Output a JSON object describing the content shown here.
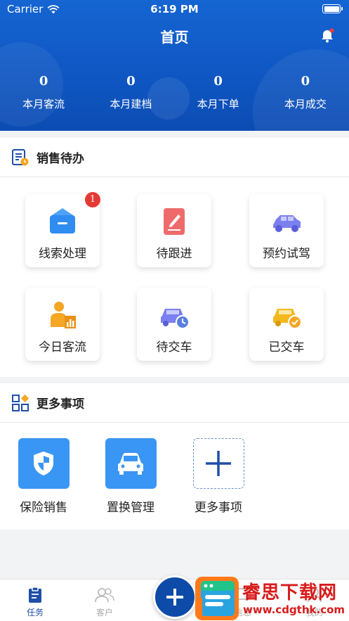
{
  "status_bar": {
    "carrier": "Carrier",
    "time": "6:19 PM"
  },
  "header": {
    "title": "首页",
    "stats": [
      {
        "value": "0",
        "label": "本月客流"
      },
      {
        "value": "0",
        "label": "本月建档"
      },
      {
        "value": "0",
        "label": "本月下单"
      },
      {
        "value": "0",
        "label": "本月成交"
      }
    ]
  },
  "sales_todo": {
    "title": "销售待办",
    "items": [
      {
        "label": "线索处理",
        "icon": "lead-inbox-icon",
        "badge": "1"
      },
      {
        "label": "待跟进",
        "icon": "follow-up-note-icon"
      },
      {
        "label": "预约试驾",
        "icon": "test-drive-car-icon"
      },
      {
        "label": "今日客流",
        "icon": "visitor-chart-icon"
      },
      {
        "label": "待交车",
        "icon": "car-clock-icon"
      },
      {
        "label": "已交车",
        "icon": "car-check-icon"
      }
    ]
  },
  "more": {
    "title": "更多事项",
    "items": [
      {
        "label": "保险销售",
        "icon": "shield-icon"
      },
      {
        "label": "置换管理",
        "icon": "car-icon"
      },
      {
        "label": "更多事项",
        "icon": "plus-icon"
      }
    ]
  },
  "tab_bar": {
    "tabs": [
      {
        "label": "任务",
        "icon": "clipboard-icon"
      },
      {
        "label": "客户",
        "icon": "users-icon"
      },
      {
        "label": "信息",
        "icon": "message-icon"
      },
      {
        "label": "我的",
        "icon": "profile-icon"
      }
    ],
    "active": "任务"
  },
  "watermark": {
    "title": "睿思下载网",
    "url": "www.cdgthk.com"
  },
  "colors": {
    "header_blue": "#1565d2",
    "accent_blue": "#3a96f4",
    "badge_red": "#e53935"
  }
}
